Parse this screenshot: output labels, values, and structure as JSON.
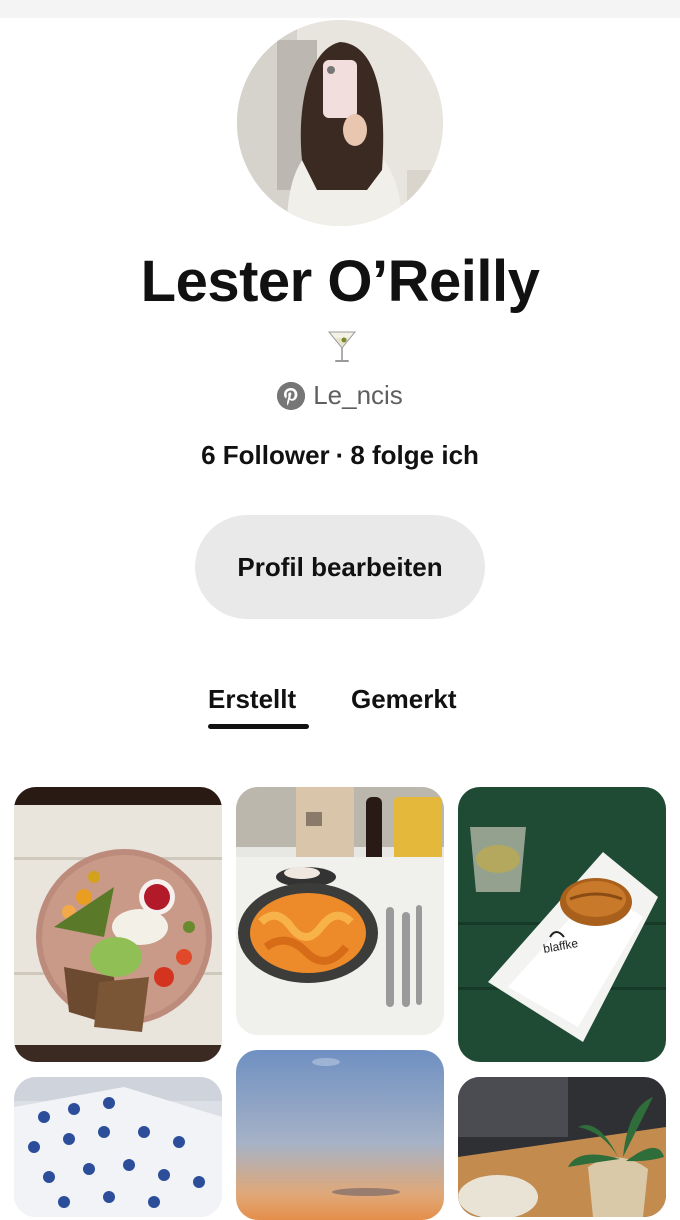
{
  "profile": {
    "name": "Lester O’Reilly",
    "bio_emoji": "🍸",
    "handle": "Le_ncis",
    "followers": "6 Follower",
    "separator": "·",
    "following": "8 folge ich",
    "edit_button": "Profil bearbeiten"
  },
  "tabs": [
    {
      "label": "Erstellt",
      "active": true
    },
    {
      "label": "Gemerkt",
      "active": false
    }
  ],
  "pins": [
    {
      "id": "pin-salad-plate",
      "subject": "salad plate"
    },
    {
      "id": "pin-pasta-dinner",
      "subject": "pasta dinner"
    },
    {
      "id": "pin-pastry-bag",
      "subject": "pastry in bag",
      "text": "blaffke"
    },
    {
      "id": "pin-porcelain",
      "subject": "blue porcelain"
    },
    {
      "id": "pin-sunset",
      "subject": "sunset sky"
    },
    {
      "id": "pin-cafe-table",
      "subject": "cafe table with plant"
    }
  ],
  "colors": {
    "button_bg": "#e9e9e9",
    "secondary_text": "#5f5f5f",
    "text": "#111111"
  }
}
